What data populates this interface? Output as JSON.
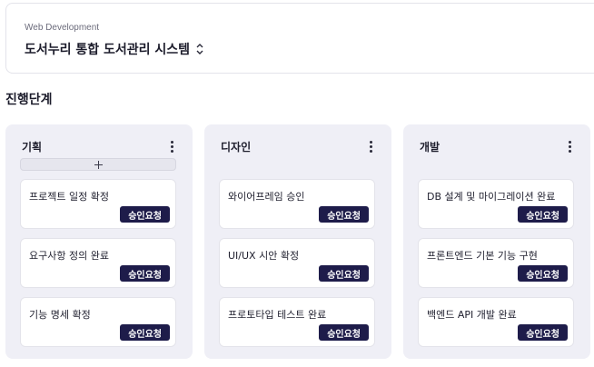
{
  "project": {
    "category": "Web Development",
    "title": "도서누리 통합 도서관리 시스템"
  },
  "section_title": "진행단계",
  "columns": [
    {
      "title": "기획",
      "tasks": [
        {
          "title": "프로젝트 일정 확정",
          "action": "승인요청"
        },
        {
          "title": "요구사항 정의 완료",
          "action": "승인요청"
        },
        {
          "title": "기능 명세 확정",
          "action": "승인요청"
        }
      ]
    },
    {
      "title": "디자인",
      "tasks": [
        {
          "title": "와이어프레임 승인",
          "action": "승인요청"
        },
        {
          "title": "UI/UX 시안 확정",
          "action": "승인요청"
        },
        {
          "title": "프로토타입 테스트 완료",
          "action": "승인요청"
        }
      ]
    },
    {
      "title": "개발",
      "tasks": [
        {
          "title": "DB 설계 및 마이그레이션 완료",
          "action": "승인요청"
        },
        {
          "title": "프론트엔드 기본 기능 구현",
          "action": "승인요청"
        },
        {
          "title": "백엔드 API 개발 완료",
          "action": "승인요청"
        }
      ]
    }
  ],
  "icons": {
    "project_selector": "chevron-up-down-icon",
    "column_menu": "kebab-menu-icon",
    "add": "plus-icon"
  },
  "colors": {
    "column_bg": "#efeff6",
    "approve_button": "#1e1c4a"
  }
}
